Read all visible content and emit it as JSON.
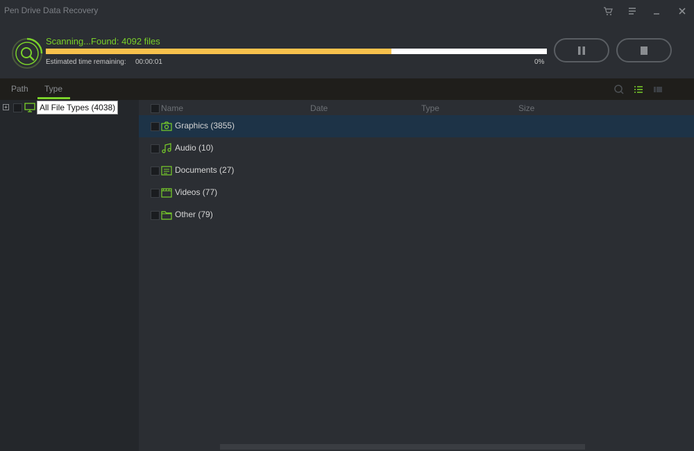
{
  "app": {
    "title": "Pen Drive Data Recovery"
  },
  "titlebar": {
    "icons": [
      "cart-icon",
      "menu-icon",
      "minimize-icon",
      "close-icon"
    ]
  },
  "scan": {
    "status": "Scanning...Found: 4092 files",
    "eta_label": "Estimated time remaining:",
    "eta_value": "00:00:01",
    "percent_label": "0%",
    "progress_fraction": 0.69,
    "colors": {
      "accent": "#7ad12a",
      "progress": "#f7c14c",
      "track": "#ffffff"
    }
  },
  "tabs": [
    {
      "label": "Path",
      "active": false
    },
    {
      "label": "Type",
      "active": true
    }
  ],
  "tree": {
    "root_label": "All File Types (4038)"
  },
  "columns": [
    "Name",
    "Date",
    "Type",
    "Size"
  ],
  "rows": [
    {
      "label": "Graphics (3855)",
      "icon": "camera-icon",
      "selected": true
    },
    {
      "label": "Audio (10)",
      "icon": "music-note-icon",
      "selected": false
    },
    {
      "label": "Documents (27)",
      "icon": "document-icon",
      "selected": false
    },
    {
      "label": "Videos (77)",
      "icon": "video-icon",
      "selected": false
    },
    {
      "label": "Other (79)",
      "icon": "folder-icon",
      "selected": false
    }
  ]
}
